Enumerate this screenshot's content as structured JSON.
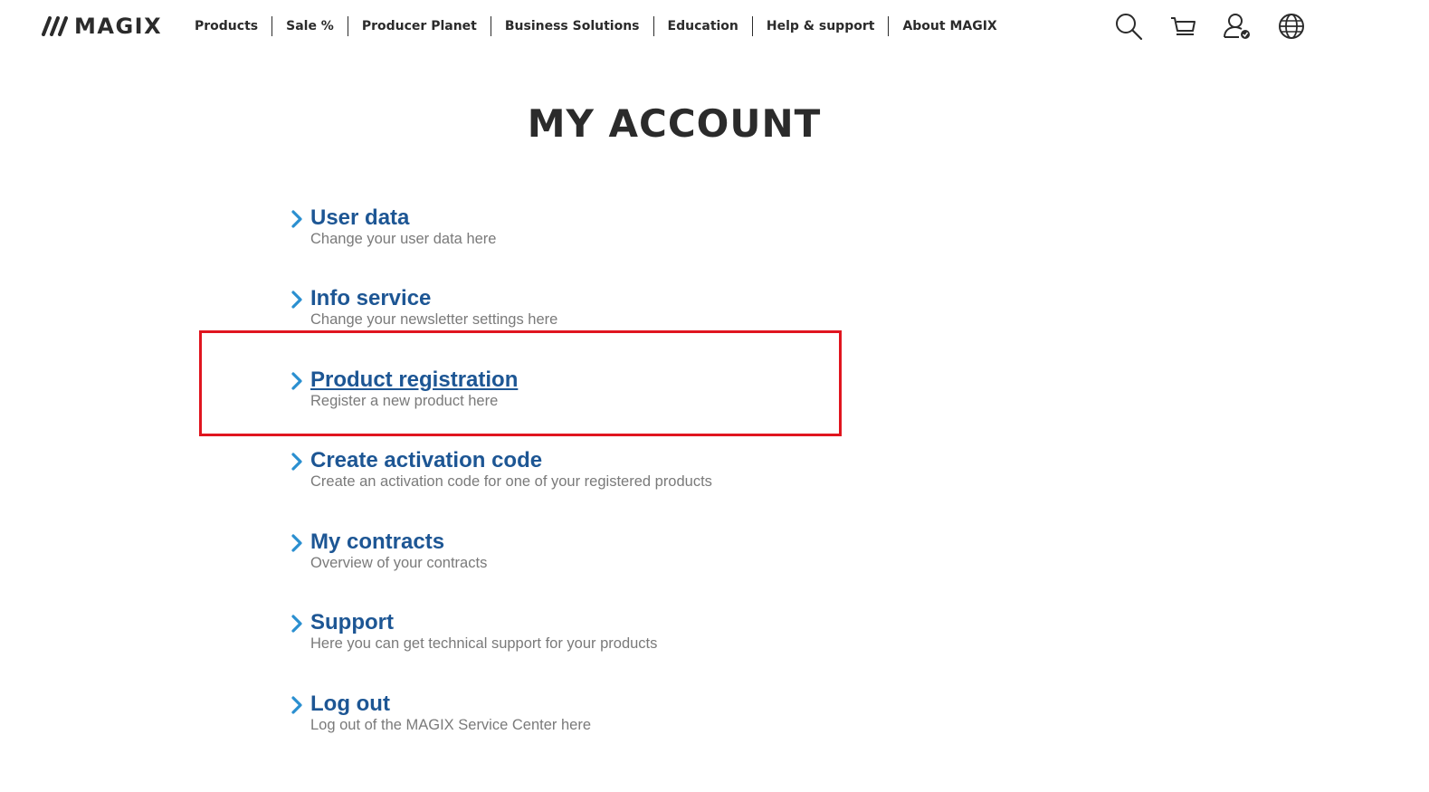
{
  "header": {
    "logo_text": "MAGIX",
    "nav": [
      {
        "label": "Products"
      },
      {
        "label": "Sale %"
      },
      {
        "label": "Producer Planet"
      },
      {
        "label": "Business Solutions"
      },
      {
        "label": "Education"
      },
      {
        "label": "Help & support"
      },
      {
        "label": "About MAGIX"
      }
    ],
    "icons": [
      "search-icon",
      "cart-icon",
      "user-account-icon",
      "globe-icon"
    ]
  },
  "page": {
    "title": "MY ACCOUNT"
  },
  "menu": [
    {
      "title": "User data",
      "description": "Change your user data here"
    },
    {
      "title": "Info service",
      "description": "Change your newsletter settings here"
    },
    {
      "title": "Product registration",
      "description": "Register a new product here"
    },
    {
      "title": "Create activation code",
      "description": "Create an activation code for one of your registered products"
    },
    {
      "title": "My contracts",
      "description": "Overview of your contracts"
    },
    {
      "title": "Support",
      "description": "Here you can get technical support for your products"
    },
    {
      "title": "Log out",
      "description": "Log out of the MAGIX Service Center here"
    }
  ],
  "colors": {
    "link": "#1d5694",
    "chevron": "#2a8fd0",
    "text_dark": "#2b2b2b",
    "description": "#7a7a7a",
    "highlight": "#e0151f"
  }
}
